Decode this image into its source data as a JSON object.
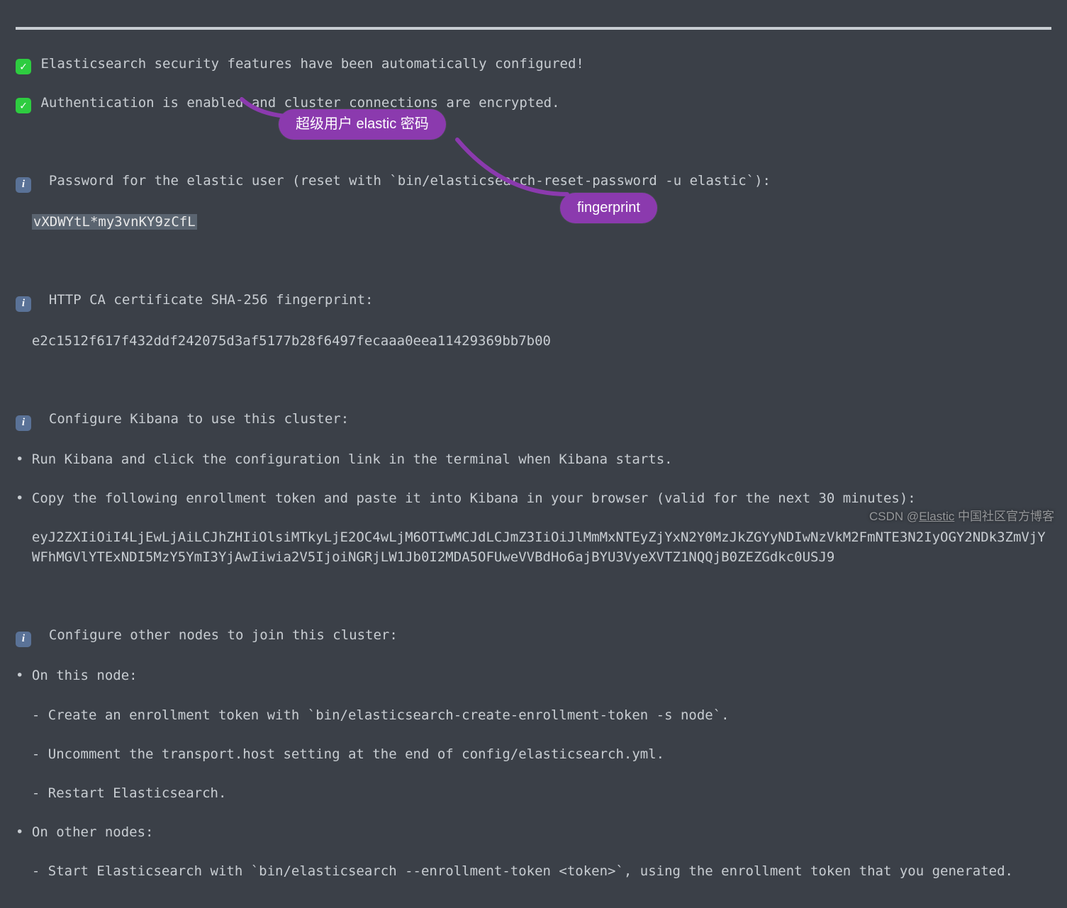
{
  "check1": "Elasticsearch security features have been automatically configured!",
  "check2": "Authentication is enabled and cluster connections are encrypted.",
  "info_password_label": "Password for the elastic user (reset with `bin/elasticsearch-reset-password -u elastic`):",
  "password_value": "vXDWYtL*my3vnKY9zCfL",
  "info_ca_label": "HTTP CA certificate SHA-256 fingerprint:",
  "ca_value": "e2c1512f617f432ddf242075d3af5177b28f6497fecaaa0eea11429369bb7b00",
  "info_kibana_label": "Configure Kibana to use this cluster:",
  "kibana_step1": "Run Kibana and click the configuration link in the terminal when Kibana starts.",
  "kibana_step2": "Copy the following enrollment token and paste it into Kibana in your browser (valid for the next 30 minutes):",
  "enrollment_token": "eyJ2ZXIiOiI4LjEwLjAiLCJhZHIiOlsiMTkyLjE2OC4wLjM6OTIwMCJdLCJmZ3IiOiJlMmMxNTEyZjYxN2Y0MzJkZGYyNDIwNzVkM2FmNTE3N2IyOGY2NDk3ZmVjYWFhMGVlYTExNDI5MzY5YmI3YjAwIiwia2V5IjoiNGRjLW1Jb0I2MDA5OFUweVVBdHo6ajBYU3VyeXVTZ1NQQjB0ZEZGdkc0USJ9",
  "info_nodes_label": "Configure other nodes to join this cluster:",
  "nodes_this": "On this node:",
  "nodes_this_1": "- Create an enrollment token with `bin/elasticsearch-create-enrollment-token -s node`.",
  "nodes_this_2": "- Uncomment the transport.host setting at the end of config/elasticsearch.yml.",
  "nodes_this_3": "- Restart Elasticsearch.",
  "nodes_other": "On other nodes:",
  "nodes_other_1": "- Start Elasticsearch with `bin/elasticsearch --enrollment-token <token>`, using the enrollment token that you generated.",
  "annotations": {
    "password_label": "超级用户 elastic 密码",
    "fingerprint_label": "fingerprint"
  },
  "watermark": {
    "prefix": "CSDN @",
    "link": "Elastic",
    "suffix": " 中国社区官方博客"
  }
}
